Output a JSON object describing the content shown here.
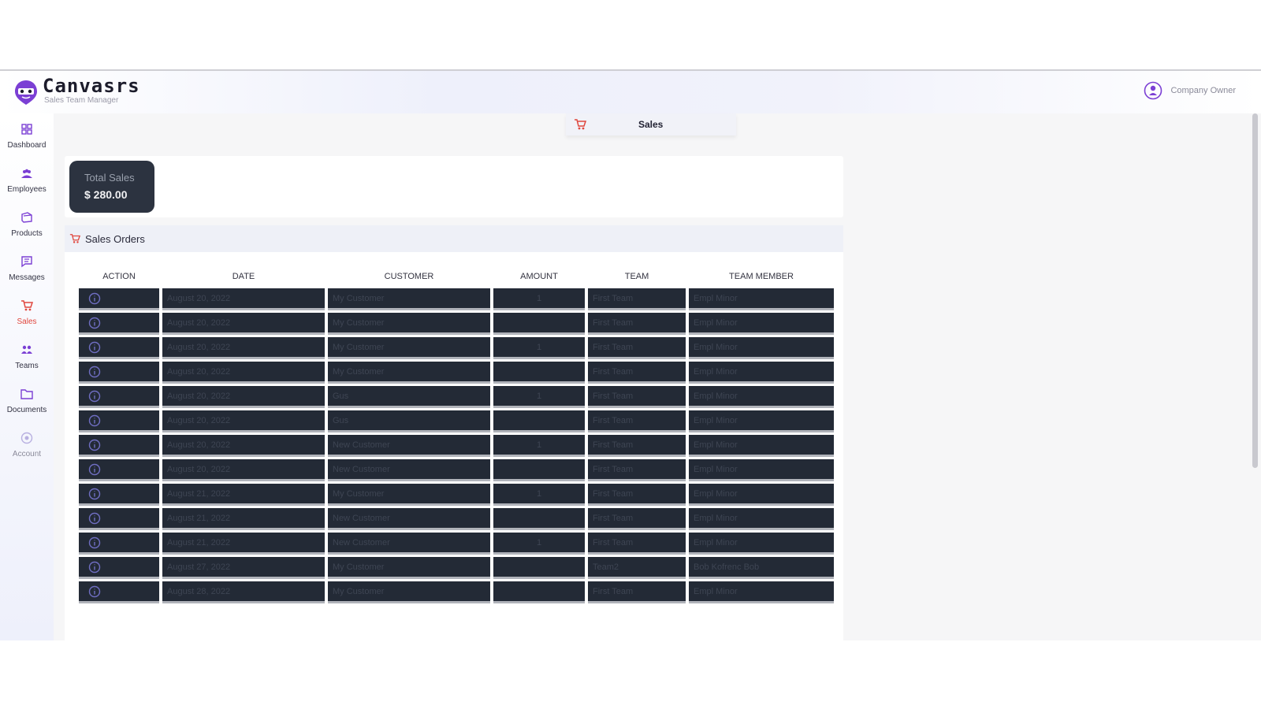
{
  "app": {
    "brand_name": "Canvasrs",
    "brand_tagline": "Sales Team Manager",
    "user_role": "Company Owner"
  },
  "sidebar": {
    "items": [
      {
        "label": "Dashboard",
        "icon": "dashboard-icon"
      },
      {
        "label": "Employees",
        "icon": "employees-icon"
      },
      {
        "label": "Products",
        "icon": "products-icon"
      },
      {
        "label": "Messages",
        "icon": "messages-icon"
      },
      {
        "label": "Sales",
        "icon": "cart-icon",
        "active": true
      },
      {
        "label": "Teams",
        "icon": "teams-icon"
      },
      {
        "label": "Documents",
        "icon": "documents-icon"
      },
      {
        "label": "Account",
        "icon": "account-icon"
      }
    ]
  },
  "tab": {
    "label": "Sales",
    "icon": "cart-icon"
  },
  "summary": {
    "label": "Total Sales",
    "value": "$ 280.00"
  },
  "orders": {
    "title": "Sales Orders",
    "columns": [
      "Action",
      "Date",
      "Customer",
      "Amount",
      "Team",
      "Team Member"
    ],
    "rows": [
      {
        "date": "August 20, 2022",
        "customer": "My Customer",
        "amount": "1",
        "team": "First Team",
        "member": "Empl Minor"
      },
      {
        "date": "August 20, 2022",
        "customer": "My Customer",
        "amount": "",
        "team": "First Team",
        "member": "Empl Minor"
      },
      {
        "date": "August 20, 2022",
        "customer": "My Customer",
        "amount": "1",
        "team": "First Team",
        "member": "Empl Minor"
      },
      {
        "date": "August 20, 2022",
        "customer": "My Customer",
        "amount": "",
        "team": "First Team",
        "member": "Empl Minor"
      },
      {
        "date": "August 20, 2022",
        "customer": "Gus",
        "amount": "1",
        "team": "First Team",
        "member": "Empl Minor"
      },
      {
        "date": "August 20, 2022",
        "customer": "Gus",
        "amount": "",
        "team": "First Team",
        "member": "Empl Minor"
      },
      {
        "date": "August 20, 2022",
        "customer": "New Customer",
        "amount": "1",
        "team": "First Team",
        "member": "Empl Minor"
      },
      {
        "date": "August 20, 2022",
        "customer": "New Customer",
        "amount": "",
        "team": "First Team",
        "member": "Empl Minor"
      },
      {
        "date": "August 21, 2022",
        "customer": "My Customer",
        "amount": "1",
        "team": "First Team",
        "member": "Empl Minor"
      },
      {
        "date": "August 21, 2022",
        "customer": "New Customer",
        "amount": "",
        "team": "First Team",
        "member": "Empl Minor"
      },
      {
        "date": "August 21, 2022",
        "customer": "New Customer",
        "amount": "1",
        "team": "First Team",
        "member": "Empl Minor"
      },
      {
        "date": "August 27, 2022",
        "customer": "My Customer",
        "amount": "",
        "team": "Team2",
        "member": "Bob Kofrenc Bob"
      },
      {
        "date": "August 28, 2022",
        "customer": "My Customer",
        "amount": "",
        "team": "First Team",
        "member": "Empl Minor"
      }
    ]
  },
  "colors": {
    "accent": "#e0473e",
    "brand_purple": "#7b3fd4",
    "row_bg": "#232a36",
    "card_bg": "#2c3340"
  }
}
